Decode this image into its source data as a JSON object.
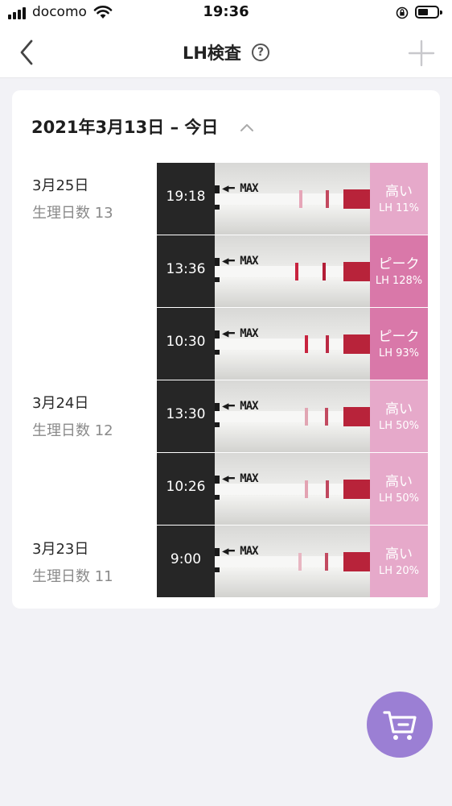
{
  "status_bar": {
    "carrier": "docomo",
    "time": "19:36"
  },
  "nav": {
    "title": "LH検査",
    "help_glyph": "?",
    "icons": [
      "back-chevron-icon",
      "help-icon",
      "add-icon"
    ]
  },
  "card": {
    "range_label": "2021年3月13日 – 今日",
    "days": [
      {
        "date": "3月25日",
        "cycle_day": "生理日数 13"
      },
      {
        "date": "3月24日",
        "cycle_day": "生理日数 12"
      },
      {
        "date": "3月23日",
        "cycle_day": "生理日数 11"
      }
    ],
    "tests": [
      {
        "time": "19:18",
        "level": "高い",
        "lh": "LH 11%",
        "color": "#e6a9ca"
      },
      {
        "time": "13:36",
        "level": "ピーク",
        "lh": "LH 128%",
        "color": "#d978a9"
      },
      {
        "time": "10:30",
        "level": "ピーク",
        "lh": "LH 93%",
        "color": "#d978a9"
      },
      {
        "time": "13:30",
        "level": "高い",
        "lh": "LH 50%",
        "color": "#e6a9ca"
      },
      {
        "time": "10:26",
        "level": "高い",
        "lh": "LH 50%",
        "color": "#e6a9ca"
      },
      {
        "time": "9:00",
        "level": "高い",
        "lh": "LH 20%",
        "color": "#e6a9ca"
      }
    ]
  },
  "cart_button": {
    "icon": "cart-icon",
    "color": "#9b7fd4"
  }
}
